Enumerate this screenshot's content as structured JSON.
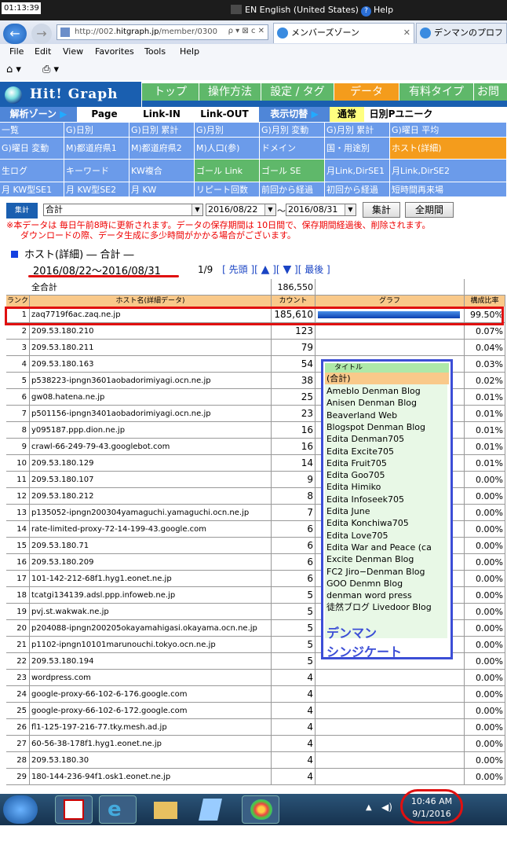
{
  "window": {
    "time": "01:13:39",
    "lang": "EN English (United States)",
    "help": "Help"
  },
  "browser": {
    "url_prefix": "http://002.",
    "url_host": "hitgraph.jp",
    "url_rest": "/member/0300",
    "tab1": "メンバーズゾーン",
    "tab2": "デンマンのプロフ"
  },
  "menu": [
    "File",
    "Edit",
    "View",
    "Favorites",
    "Tools",
    "Help"
  ],
  "logo": "Hit! Graph",
  "topnav": [
    "トップ",
    "操作方法",
    "設定 / タグ",
    "データ",
    "有料タイプ",
    "お問"
  ],
  "sub": {
    "zone": "解析ゾーン",
    "page": "Page",
    "link_in": "Link-IN",
    "link_out": "Link-OUT",
    "switch": "表示切替",
    "normal": "通常",
    "daily": "日別Pユニーク"
  },
  "grid": [
    [
      "一覧",
      "G)日別",
      "G)日別 累計",
      "G)月別",
      "G)月別 変動",
      "G)月別 累計",
      "G)曜日 平均"
    ],
    [
      "G)曜日 変動",
      "M)都道府県1",
      "M)都道府県2",
      "M)人口(参)",
      "ドメイン",
      "国・用途別",
      "ホスト(詳細)"
    ],
    [
      "生ログ",
      "キーワード",
      "KW複合",
      "ゴール Link",
      "ゴール SE",
      "月Link,DirSE1",
      "月Link,DirSE2"
    ],
    [
      "月 KW型SE1",
      "月 KW型SE2",
      "月 KW",
      "リピート回数",
      "前回から経過",
      "初回から経過",
      "短時間再来場"
    ]
  ],
  "form": {
    "label": "集計",
    "select": "合計",
    "from": "2016/08/22",
    "tilde": "～",
    "to": "2016/08/31",
    "go": "集計",
    "all": "全期間"
  },
  "notice1": "※本データは 毎日午前8時に更新されます。データの保存期間は 10日間で、保存期間経過後、削除されます。",
  "notice2": "ダウンロードの際、データ生成に多少時間がかかる場合がございます。",
  "section": "ホスト(詳細) ― 合計 ―",
  "daterange": "2016/08/22～2016/08/31",
  "pager": {
    "page": "1/9",
    "first": "[ 先頭 ][",
    "last": "][ 最後 ]"
  },
  "table": {
    "total_label": "全合計",
    "total_value": "186,550",
    "headers": [
      "ランク",
      "ホスト名(詳細データ)",
      "カウント",
      "グラフ",
      "構成比率"
    ],
    "rows": [
      [
        "1",
        "zaq7719f6ac.zaq.ne.jp",
        "185,610",
        "99.50%"
      ],
      [
        "2",
        "209.53.180.210",
        "123",
        "0.07%"
      ],
      [
        "3",
        "209.53.180.211",
        "79",
        "0.04%"
      ],
      [
        "4",
        "209.53.180.163",
        "54",
        "0.03%"
      ],
      [
        "5",
        "p538223-ipngn3601aobadorimiyagi.ocn.ne.jp",
        "38",
        "0.02%"
      ],
      [
        "6",
        "gw08.hatena.ne.jp",
        "25",
        "0.01%"
      ],
      [
        "7",
        "p501156-ipngn3401aobadorimiyagi.ocn.ne.jp",
        "23",
        "0.01%"
      ],
      [
        "8",
        "y095187.ppp.dion.ne.jp",
        "16",
        "0.01%"
      ],
      [
        "9",
        "crawl-66-249-79-43.googlebot.com",
        "16",
        "0.01%"
      ],
      [
        "10",
        "209.53.180.129",
        "14",
        "0.01%"
      ],
      [
        "11",
        "209.53.180.107",
        "9",
        "0.00%"
      ],
      [
        "12",
        "209.53.180.212",
        "8",
        "0.00%"
      ],
      [
        "13",
        "p135052-ipngn200304yamaguchi.yamaguchi.ocn.ne.jp",
        "7",
        "0.00%"
      ],
      [
        "14",
        "rate-limited-proxy-72-14-199-43.google.com",
        "6",
        "0.00%"
      ],
      [
        "15",
        "209.53.180.71",
        "6",
        "0.00%"
      ],
      [
        "16",
        "209.53.180.209",
        "6",
        "0.00%"
      ],
      [
        "17",
        "101-142-212-68f1.hyg1.eonet.ne.jp",
        "6",
        "0.00%"
      ],
      [
        "18",
        "tcatgi134139.adsl.ppp.infoweb.ne.jp",
        "5",
        "0.00%"
      ],
      [
        "19",
        "pvj.st.wakwak.ne.jp",
        "5",
        "0.00%"
      ],
      [
        "20",
        "p204088-ipngn200205okayamahigasi.okayama.ocn.ne.jp",
        "5",
        "0.00%"
      ],
      [
        "21",
        "p1102-ipngn10101marunouchi.tokyo.ocn.ne.jp",
        "5",
        "0.00%"
      ],
      [
        "22",
        "209.53.180.194",
        "5",
        "0.00%"
      ],
      [
        "23",
        "wordpress.com",
        "4",
        "0.00%"
      ],
      [
        "24",
        "google-proxy-66-102-6-176.google.com",
        "4",
        "0.00%"
      ],
      [
        "25",
        "google-proxy-66-102-6-172.google.com",
        "4",
        "0.00%"
      ],
      [
        "26",
        "fl1-125-197-216-77.tky.mesh.ad.jp",
        "4",
        "0.00%"
      ],
      [
        "27",
        "60-56-38-178f1.hyg1.eonet.ne.jp",
        "4",
        "0.00%"
      ],
      [
        "28",
        "209.53.180.30",
        "4",
        "0.00%"
      ],
      [
        "29",
        "180-144-236-94f1.osk1.eonet.ne.jp",
        "4",
        "0.00%"
      ]
    ]
  },
  "legend": {
    "title": "タイトル",
    "selected": "(合計)",
    "items": [
      "Ameblo Denman Blog",
      "Anisen Denman Blog",
      "Beaverland Web",
      "Blogspot Denman Blog",
      "Edita Denman705",
      "Edita Excite705",
      "Edita Fruit705",
      "Edita Goo705",
      "Edita Himiko",
      "Edita Infoseek705",
      "Edita June",
      "Edita Konchiwa705",
      "Edita Love705",
      "Edita War and Peace (ca",
      "Excite Denman Blog",
      "FC2 Jiro−Denman Blog",
      "GOO Denmn Blog",
      "denman word press",
      "徒然ブログ Livedoor Blog"
    ],
    "big1": "デンマン",
    "big2": "シンジケート"
  },
  "clock": {
    "time": "10:46 AM",
    "date": "9/1/2016"
  },
  "colors": {
    "blue": "#6b9bea",
    "orange": "#f49c1c",
    "green": "#5fb86a",
    "red": "#e01010",
    "legendborder": "#3c4ed6"
  }
}
